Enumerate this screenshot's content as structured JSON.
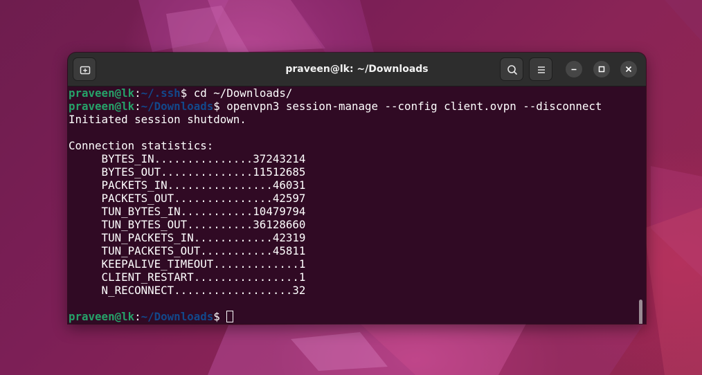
{
  "desktop": {
    "accent_color": "#77216f"
  },
  "window": {
    "title": "praveen@lk: ~/Downloads",
    "buttons": {
      "new_tab_icon": "new-tab-icon",
      "search_icon": "search-icon",
      "menu_icon": "hamburger-menu-icon",
      "minimize_icon": "minimize-icon",
      "maximize_icon": "maximize-icon",
      "close_icon": "close-icon"
    }
  },
  "terminal": {
    "colors": {
      "background": "#300a24",
      "user": "#26a269",
      "path": "#12488b",
      "text": "#ffffff"
    },
    "lines": [
      {
        "type": "prompt",
        "user": "praveen@lk",
        "sep": ":",
        "path": "~/.ssh",
        "dollar": "$",
        "cmd": " cd ~/Downloads/"
      },
      {
        "type": "prompt",
        "user": "praveen@lk",
        "sep": ":",
        "path": "~/Downloads",
        "dollar": "$",
        "cmd": " openvpn3 session-manage --config client.ovpn --disconnect"
      },
      {
        "type": "output",
        "text": "Initiated session shutdown."
      },
      {
        "type": "output",
        "text": ""
      },
      {
        "type": "output",
        "text": "Connection statistics:"
      },
      {
        "type": "output",
        "text": "     BYTES_IN...............37243214"
      },
      {
        "type": "output",
        "text": "     BYTES_OUT..............11512685"
      },
      {
        "type": "output",
        "text": "     PACKETS_IN................46031"
      },
      {
        "type": "output",
        "text": "     PACKETS_OUT...............42597"
      },
      {
        "type": "output",
        "text": "     TUN_BYTES_IN...........10479794"
      },
      {
        "type": "output",
        "text": "     TUN_BYTES_OUT..........36128660"
      },
      {
        "type": "output",
        "text": "     TUN_PACKETS_IN............42319"
      },
      {
        "type": "output",
        "text": "     TUN_PACKETS_OUT...........45811"
      },
      {
        "type": "output",
        "text": "     KEEPALIVE_TIMEOUT.............1"
      },
      {
        "type": "output",
        "text": "     CLIENT_RESTART................1"
      },
      {
        "type": "output",
        "text": "     N_RECONNECT..................32"
      },
      {
        "type": "output",
        "text": ""
      },
      {
        "type": "prompt",
        "user": "praveen@lk",
        "sep": ":",
        "path": "~/Downloads",
        "dollar": "$",
        "cmd": " ",
        "cursor": true
      }
    ]
  }
}
